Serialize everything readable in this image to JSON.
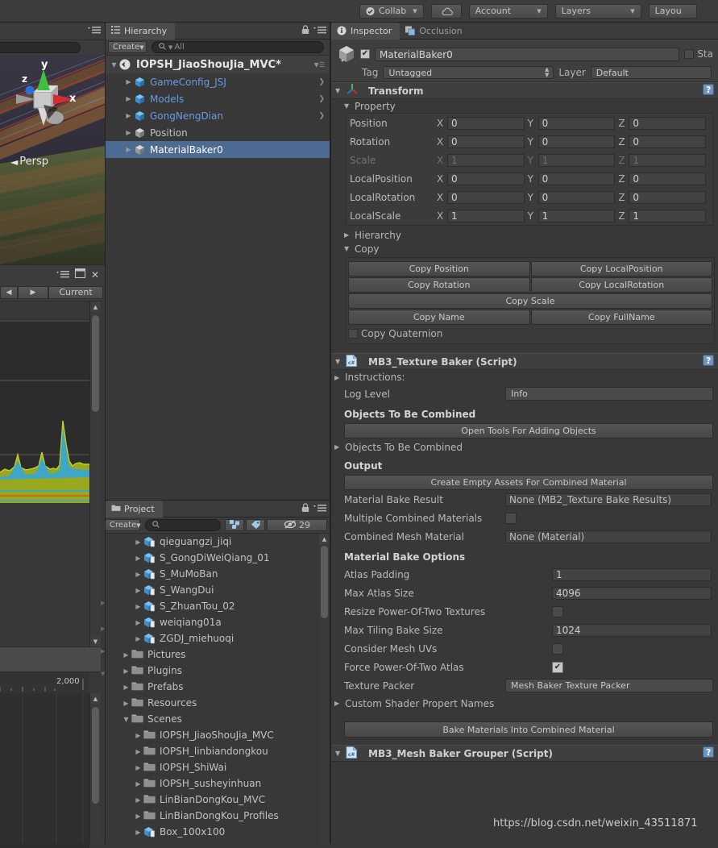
{
  "toolbar": {
    "collab_label": "Collab",
    "collab_checked": true,
    "cloud_icon": "cloud-icon",
    "account_label": "Account",
    "layers_label": "Layers",
    "layout_label": "Layou"
  },
  "scene_view": {
    "gizmo": {
      "x_label": "x",
      "y_label": "y",
      "z_label": "z"
    },
    "projection_label": "Persp"
  },
  "profiler": {
    "prev_frame_icon": "previous-frame-icon",
    "next_frame_icon": "next-frame-icon",
    "current_label": "Current",
    "axis_label": "2,000"
  },
  "hierarchy": {
    "tab_label": "Hierarchy",
    "lock_icon": "lock-icon",
    "menu_icon": "panel-menu-icon",
    "create_label": "Create",
    "search_placeholder": "All",
    "search_icon": "search-icon",
    "scene_label": "IOPSH_JiaoShouJia_MVC*",
    "items": [
      {
        "label": "GameConfig_JSJ",
        "icon": "prefab-cube-icon",
        "prefab": true,
        "selected": false,
        "has_children": true
      },
      {
        "label": "Models",
        "icon": "prefab-cube-icon",
        "prefab": true,
        "selected": false,
        "has_children": true
      },
      {
        "label": "GongNengDian",
        "icon": "prefab-cube-icon",
        "prefab": true,
        "selected": false,
        "has_children": true
      },
      {
        "label": "Position",
        "icon": "gameobject-cube-icon",
        "prefab": false,
        "selected": false,
        "has_children": false
      },
      {
        "label": "MaterialBaker0",
        "icon": "gameobject-cube-icon",
        "prefab": false,
        "selected": true,
        "has_children": false
      }
    ]
  },
  "project": {
    "tab_label": "Project",
    "lock_icon": "lock-icon",
    "menu_icon": "panel-menu-icon",
    "create_label": "Create",
    "search_placeholder": "",
    "search_icon": "search-icon",
    "filter_type_icon": "filter-by-type-icon",
    "filter_label_icon": "filter-by-label-icon",
    "visibility_icon": "hidden-assets-icon",
    "visibility_count": "29",
    "items": [
      {
        "label": "qieguangzi_jiqi",
        "icon": "model-icon",
        "indent": 2
      },
      {
        "label": "S_GongDiWeiQiang_01",
        "icon": "model-icon",
        "indent": 2
      },
      {
        "label": "S_MuMoBan",
        "icon": "model-icon",
        "indent": 2
      },
      {
        "label": "S_WangDui",
        "icon": "model-icon",
        "indent": 2
      },
      {
        "label": "S_ZhuanTou_02",
        "icon": "model-icon",
        "indent": 2
      },
      {
        "label": "weiqiang01a",
        "icon": "model-icon",
        "indent": 2
      },
      {
        "label": "ZGDJ_miehuoqi",
        "icon": "model-icon",
        "indent": 2
      },
      {
        "label": "Pictures",
        "icon": "folder-icon",
        "indent": 1
      },
      {
        "label": "Plugins",
        "icon": "folder-icon",
        "indent": 1
      },
      {
        "label": "Prefabs",
        "icon": "folder-icon",
        "indent": 1
      },
      {
        "label": "Resources",
        "icon": "folder-icon",
        "indent": 1
      },
      {
        "label": "Scenes",
        "icon": "folder-icon",
        "indent": 1,
        "expanded": true
      },
      {
        "label": "IOPSH_JiaoShouJia_MVC",
        "icon": "folder-icon",
        "indent": 2
      },
      {
        "label": "IOPSH_linbiandongkou",
        "icon": "folder-icon",
        "indent": 2
      },
      {
        "label": "IOPSH_ShiWai",
        "icon": "folder-icon",
        "indent": 2
      },
      {
        "label": "IOPSH_susheyinhuan",
        "icon": "folder-icon",
        "indent": 2
      },
      {
        "label": "LinBianDongKou_MVC",
        "icon": "folder-icon",
        "indent": 2
      },
      {
        "label": "LinBianDongKou_Profiles",
        "icon": "folder-icon",
        "indent": 2
      },
      {
        "label": "Box_100x100",
        "icon": "model-icon",
        "indent": 2
      }
    ]
  },
  "inspector": {
    "tabs": [
      {
        "label": "Inspector",
        "icon": "inspector-info-icon",
        "active": true
      },
      {
        "label": "Occlusion",
        "icon": "occlusion-icon",
        "active": false
      }
    ],
    "object": {
      "enabled_checkbox": true,
      "name": "MaterialBaker0",
      "static_label": "Sta",
      "static_checked": false,
      "tag_label": "Tag",
      "tag_value": "Untagged",
      "layer_label": "Layer",
      "layer_value": "Default"
    },
    "transform": {
      "title": "Transform",
      "icon": "transform-gizmo-icon",
      "help_icon": "help-icon",
      "property_section": "Property",
      "rows": [
        {
          "name": "Position",
          "x": "0",
          "y": "0",
          "z": "0",
          "dim": false
        },
        {
          "name": "Rotation",
          "x": "0",
          "y": "0",
          "z": "0",
          "dim": false
        },
        {
          "name": "Scale",
          "x": "1",
          "y": "1",
          "z": "1",
          "dim": true
        },
        {
          "name": "LocalPosition",
          "x": "0",
          "y": "0",
          "z": "0",
          "dim": false
        },
        {
          "name": "LocalRotation",
          "x": "0",
          "y": "0",
          "z": "0",
          "dim": false
        },
        {
          "name": "LocalScale",
          "x": "1",
          "y": "1",
          "z": "1",
          "dim": false
        }
      ],
      "axis_x": "X",
      "axis_y": "Y",
      "axis_z": "Z",
      "hierarchy_section": "Hierarchy",
      "copy_section": "Copy",
      "copy_buttons": [
        [
          "Copy Position",
          "Copy LocalPosition"
        ],
        [
          "Copy Rotation",
          "Copy LocalRotation"
        ]
      ],
      "copy_scale": "Copy Scale",
      "copy_name_row": [
        "Copy Name",
        "Copy FullName"
      ],
      "copy_quaternion_label": "Copy Quaternion",
      "copy_quaternion_checked": false
    },
    "texture_baker": {
      "title": "MB3_Texture Baker (Script)",
      "script_icon": "cs-script-icon",
      "help_icon": "help-icon",
      "instructions_label": "Instructions:",
      "log_level_label": "Log Level",
      "log_level_value": "Info",
      "objects_header": "Objects To Be Combined",
      "open_tools_button": "Open Tools For Adding Objects",
      "objects_foldout": "Objects To Be Combined",
      "output_header": "Output",
      "create_empty_button": "Create Empty Assets For Combined Material",
      "material_bake_result_label": "Material Bake Result",
      "material_bake_result_value": "None (MB2_Texture Bake Results)",
      "multiple_combined_label": "Multiple Combined Materials",
      "multiple_combined_checked": false,
      "combined_mesh_material_label": "Combined Mesh Material",
      "combined_mesh_material_value": "None (Material)",
      "bake_options_header": "Material Bake Options",
      "options": [
        {
          "label": "Atlas Padding",
          "type": "text",
          "value": "1"
        },
        {
          "label": "Max Atlas Size",
          "type": "text",
          "value": "4096"
        },
        {
          "label": "Resize Power-Of-Two Textures",
          "type": "checkbox",
          "checked": false
        },
        {
          "label": "Max Tiling Bake Size",
          "type": "text",
          "value": "1024"
        },
        {
          "label": "Consider Mesh UVs",
          "type": "checkbox",
          "checked": false
        },
        {
          "label": "Force Power-Of-Two Atlas",
          "type": "checkbox",
          "checked": true
        },
        {
          "label": "Texture Packer",
          "type": "popup",
          "value": "Mesh Baker Texture Packer"
        }
      ],
      "custom_shader_foldout": "Custom Shader Propert Names",
      "bake_button": "Bake Materials Into Combined Material"
    },
    "mesh_baker_grouper": {
      "title": "MB3_Mesh Baker Grouper (Script)",
      "script_icon": "cs-script-icon",
      "help_icon": "help-icon"
    }
  },
  "watermark": "https://blog.csdn.net/weixin_43511871",
  "colors": {
    "panel_bg": "#383838",
    "tab_active": "#4c4c4c",
    "selection": "#4c6a92",
    "text": "#b4b4b4",
    "prefab_text": "#6a9ae0",
    "graph_green": "#9aa81f",
    "graph_blue": "#3aa6d0",
    "graph_orange": "#c8661e",
    "graph_yellow": "#d4c628"
  }
}
